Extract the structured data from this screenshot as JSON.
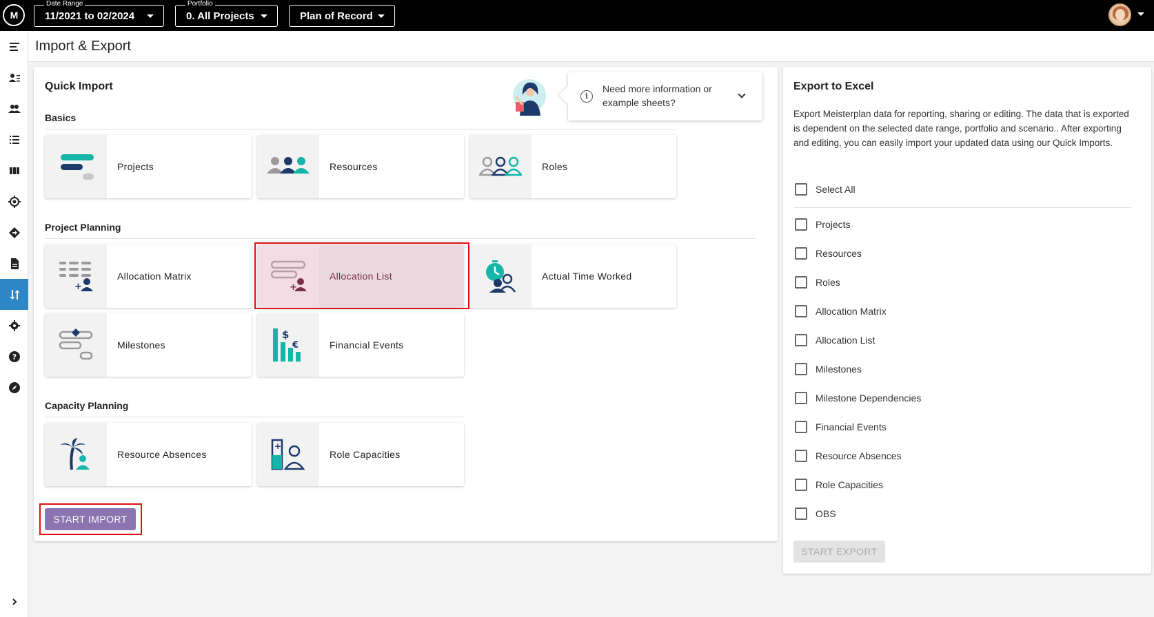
{
  "topbar": {
    "logo_text": "M",
    "date_range": {
      "label": "Date Range",
      "value": "11/2021 to 02/2024"
    },
    "portfolio": {
      "label": "Portfolio",
      "value": "0. All Projects"
    },
    "scenario": {
      "value": "Plan of Record"
    }
  },
  "sidebar": {
    "items": [
      {
        "icon": "menu-toggle-icon"
      },
      {
        "icon": "person-list-icon"
      },
      {
        "icon": "people-icon"
      },
      {
        "icon": "list-icon"
      },
      {
        "icon": "columns-icon"
      },
      {
        "icon": "target-icon"
      },
      {
        "icon": "diamond-route-icon"
      },
      {
        "icon": "document-icon"
      },
      {
        "icon": "import-export-icon",
        "active": true
      },
      {
        "icon": "gear-icon"
      },
      {
        "icon": "help-icon"
      },
      {
        "icon": "compass-icon"
      },
      {
        "icon": "expand-chevron-icon"
      }
    ]
  },
  "page": {
    "title": "Import & Export"
  },
  "quick_import": {
    "title": "Quick Import",
    "help_text": "Need more information or example sheets?",
    "sections": [
      {
        "title": "Basics",
        "tiles": [
          "Projects",
          "Resources",
          "Roles"
        ]
      },
      {
        "title": "Project Planning",
        "tiles": [
          "Allocation Matrix",
          "Allocation List",
          "Actual Time Worked",
          "Milestones",
          "Financial Events"
        ]
      },
      {
        "title": "Capacity Planning",
        "tiles": [
          "Resource Absences",
          "Role Capacities"
        ]
      }
    ],
    "selected_tile": "Allocation List",
    "start_button": "START IMPORT"
  },
  "export": {
    "title": "Export to Excel",
    "description": "Export Meisterplan data for reporting, sharing or editing. The data that is exported is dependent on the selected date range, portfolio and scenario.. After exporting and editing, you can easily import your updated data using our Quick Imports.",
    "select_all": "Select All",
    "items": [
      "Projects",
      "Resources",
      "Roles",
      "Allocation Matrix",
      "Allocation List",
      "Milestones",
      "Milestone Dependencies",
      "Financial Events",
      "Resource Absences",
      "Role Capacities",
      "OBS"
    ],
    "start_button": "START EXPORT"
  },
  "colors": {
    "accent_purple": "#8b74b0",
    "teal": "#15b5a8",
    "navy": "#1e3a6b",
    "sidebar_active": "#2f86c7",
    "highlight_red": "#e01010"
  }
}
